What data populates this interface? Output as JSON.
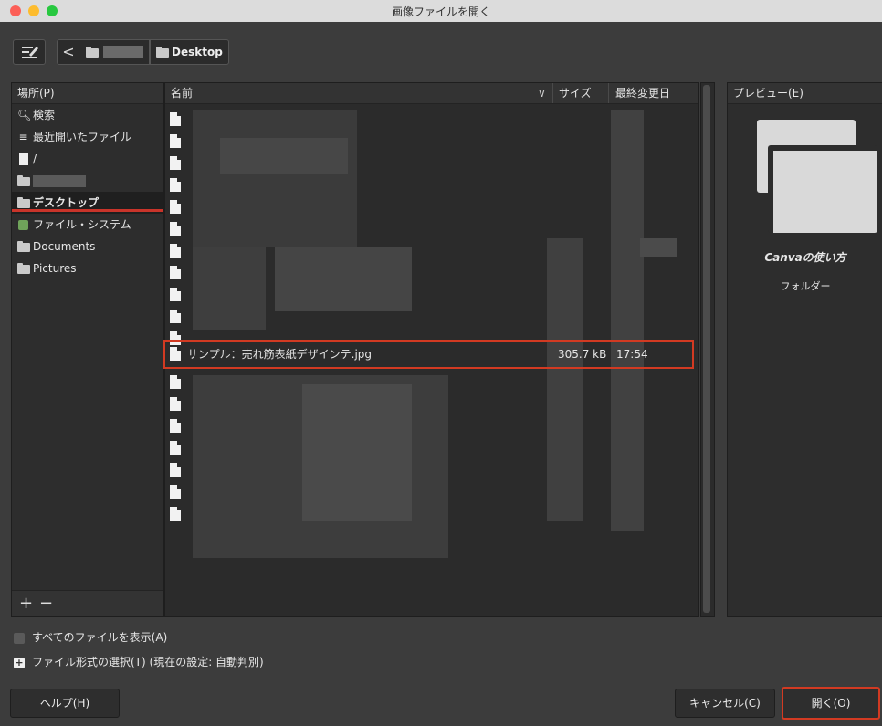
{
  "window": {
    "title": "画像ファイルを開く"
  },
  "toolbar": {
    "back_label": "<",
    "crumb_current": "Desktop"
  },
  "places": {
    "header": "場所(P)",
    "items": [
      {
        "icon": "search-icon",
        "label": "検索"
      },
      {
        "icon": "recent-icon",
        "label": "最近開いたファイル"
      },
      {
        "icon": "file-icon",
        "label": "/"
      },
      {
        "icon": "folder-icon",
        "label": ""
      },
      {
        "icon": "folder-icon",
        "label": "デスクトップ",
        "selected": true
      },
      {
        "icon": "filesystem-icon",
        "label": "ファイル・システム"
      },
      {
        "icon": "folder-icon",
        "label": "Documents"
      },
      {
        "icon": "folder-icon",
        "label": "Pictures"
      }
    ],
    "add": "+",
    "remove": "−"
  },
  "files": {
    "columns": {
      "name": "名前",
      "size": "サイズ",
      "modified": "最終変更日"
    },
    "highlighted": {
      "name": "サンプル：売れ筋表紙デザインテ.jpg",
      "size": "305.7 kB",
      "modified": "17:54"
    }
  },
  "preview": {
    "header": "プレビュー(E)",
    "name": "Canvaの使い方",
    "type": "フォルダー"
  },
  "options": {
    "show_all": "すべてのファイルを表示(A)",
    "file_type": "ファイル形式の選択(T) (現在の設定: 自動判別)"
  },
  "buttons": {
    "help": "ヘルプ(H)",
    "cancel": "キャンセル(C)",
    "open": "開く(O)"
  }
}
